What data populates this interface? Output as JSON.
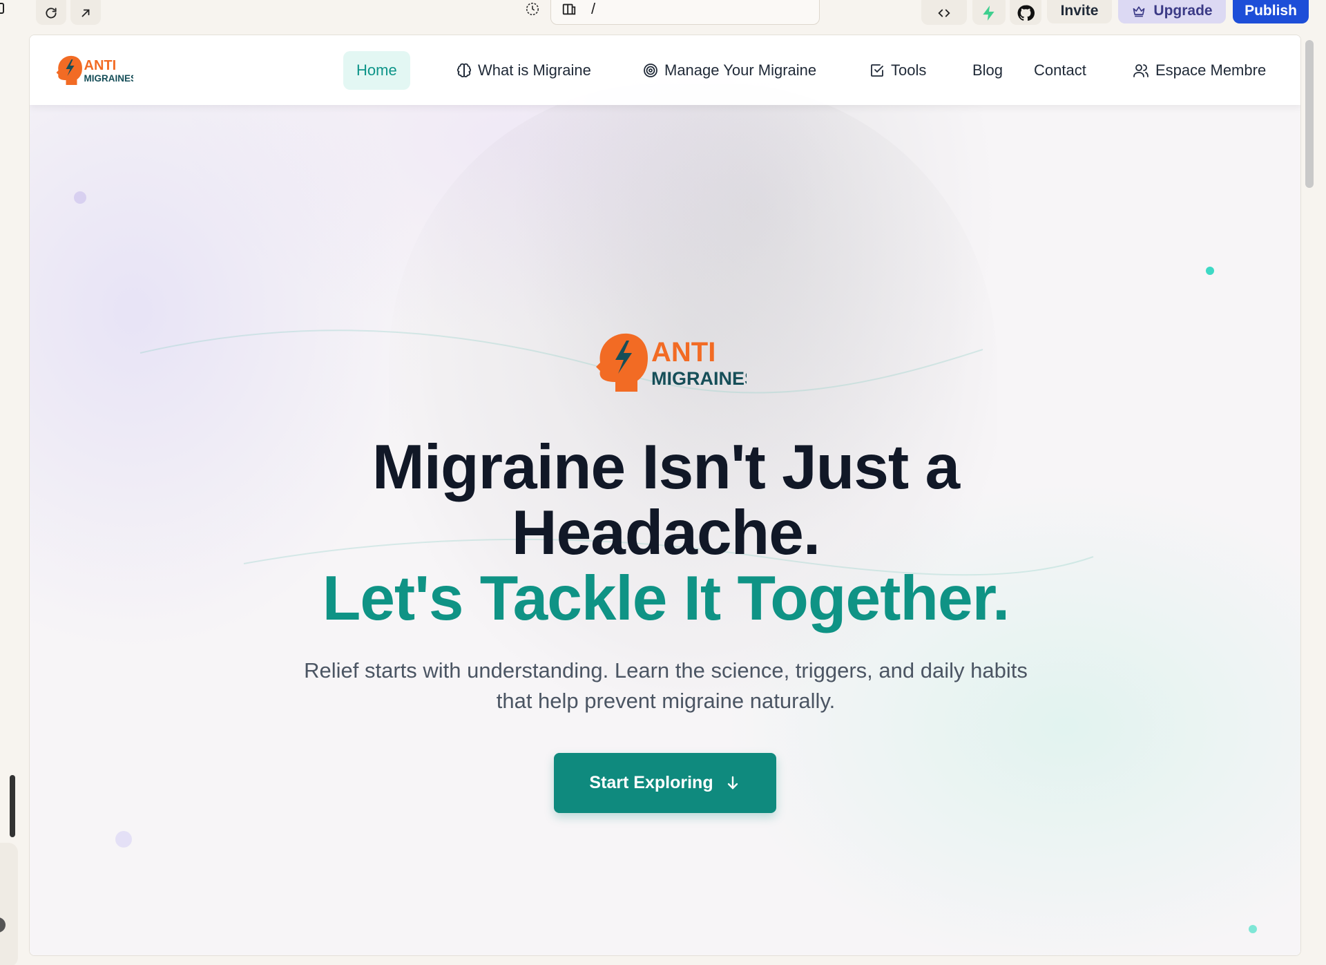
{
  "builder": {
    "url_path": "/",
    "invite_label": "Invite",
    "upgrade_label": "Upgrade",
    "publish_label": "Publish"
  },
  "logo": {
    "line1": "ANTI",
    "line2": "MIGRAINES"
  },
  "nav": {
    "items": [
      {
        "label": "Home",
        "icon": "none",
        "active": true
      },
      {
        "label": "What is Migraine",
        "icon": "brain-icon"
      },
      {
        "label": "Manage Your Migraine",
        "icon": "target-icon"
      },
      {
        "label": "Tools",
        "icon": "checkbox-icon"
      },
      {
        "label": "Blog",
        "icon": "none"
      },
      {
        "label": "Contact",
        "icon": "none"
      },
      {
        "label": "Espace Membre",
        "icon": "users-icon"
      }
    ]
  },
  "hero": {
    "headline_line1": "Migraine Isn't Just a",
    "headline_line2": "Headache.",
    "headline_accent": "Let's Tackle It Together.",
    "subtitle": "Relief starts with understanding. Learn the science, triggers, and daily habits that help prevent migraine naturally.",
    "cta_label": "Start Exploring"
  },
  "colors": {
    "brand_orange": "#f26b24",
    "brand_teal": "#0f9385",
    "cta_bg": "#0f8a7e",
    "nav_active_bg": "#e3f7f3",
    "publish_blue": "#1d4ed8"
  }
}
